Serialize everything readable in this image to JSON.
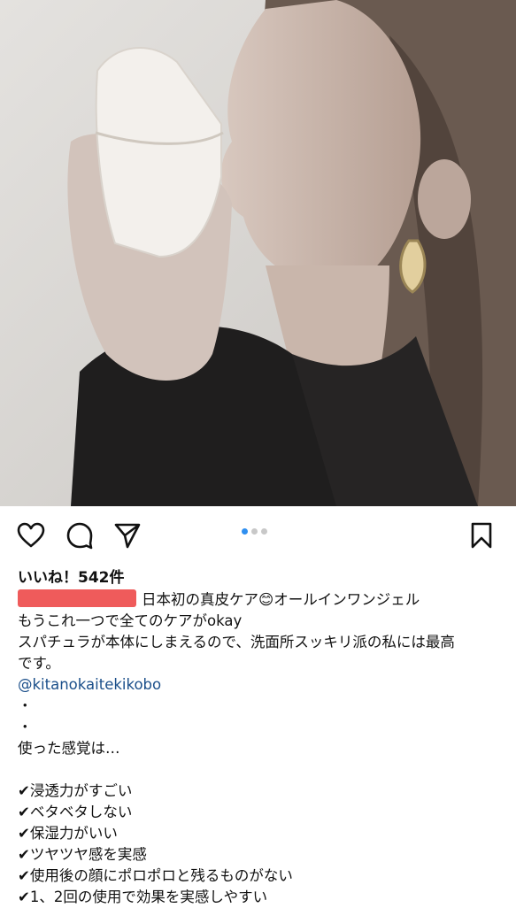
{
  "post": {
    "image_alt": "woman holding skincare product",
    "carousel": {
      "count": 3,
      "active_index": 0
    },
    "icons": {
      "like": "heart-icon",
      "comment": "comment-icon",
      "share": "send-icon",
      "save": "bookmark-icon"
    },
    "likes_text": "いいね！542件",
    "caption": {
      "line1": "日本初の真皮ケア😊オールインワンジェル",
      "line2": "もうこれ一つで全てのケアがokay",
      "line3": "スパチュラが本体にしまえるので、洗面所スッキリ派の私には最高",
      "line4": "です。",
      "mention": "@kitanokaitekikobo",
      "dot1": "・",
      "dot2": "・",
      "line5": "使った感覚は…",
      "checks": [
        "✔浸透力がすごい",
        "✔ベタベタしない",
        "✔保湿力がいい",
        "✔ツヤツヤ感を実感",
        "✔使用後の顔にポロポロと残るものがない",
        "✔1、2回の使用で効果を実感しやすい"
      ]
    }
  },
  "colors": {
    "accent": "#2f8ff0",
    "mention": "#1b4f8a",
    "redaction": "#ef5b5b"
  }
}
